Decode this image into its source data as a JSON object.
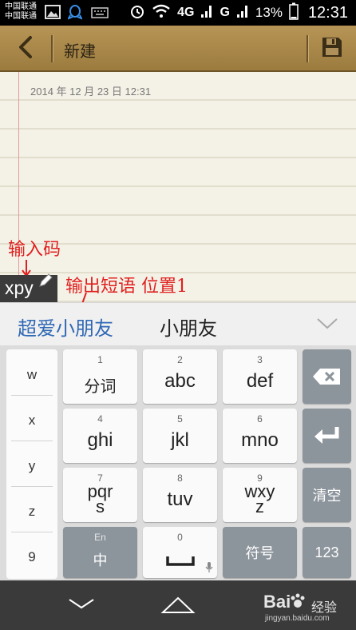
{
  "status_bar": {
    "carrier_1": "中国联通",
    "carrier_2": "中国联通",
    "network_label": "4G",
    "signal2_label": "G",
    "battery": "13%",
    "time": "12:31",
    "icons": [
      "image-icon",
      "qq-icon",
      "keyboard-icon",
      "alarm-icon",
      "wifi-icon",
      "signal-icon",
      "battery-icon"
    ]
  },
  "title_bar": {
    "title": "新建",
    "back_icon": "chevron-left-icon",
    "save_icon": "save-icon"
  },
  "note": {
    "date": "2014 年 12 月 23 日 12:31"
  },
  "annotations": {
    "input_code": "输入码",
    "output_phrase": "输出短语 位置1"
  },
  "ime": {
    "composing": "xpy",
    "candidates": [
      "超爱小朋友",
      "小朋友"
    ],
    "left_column": [
      "w",
      "x",
      "y",
      "z",
      "9"
    ],
    "keys": {
      "k1": {
        "num": "1",
        "label": "分词"
      },
      "k2": {
        "num": "2",
        "label": "abc"
      },
      "k3": {
        "num": "3",
        "label": "def"
      },
      "k4": {
        "num": "4",
        "label": "ghi"
      },
      "k5": {
        "num": "5",
        "label": "jkl"
      },
      "k6": {
        "num": "6",
        "label": "mno"
      },
      "k7": {
        "num": "7",
        "label_top": "pqr",
        "label_bottom": "s"
      },
      "k8": {
        "num": "8",
        "label": "tuv"
      },
      "k9": {
        "num": "9",
        "label_top": "wxy",
        "label_bottom": "z"
      },
      "k0": {
        "num": "0"
      },
      "en": {
        "small": "En",
        "label": "中"
      },
      "symbol": "符号",
      "clear": "清空",
      "num_switch": "123"
    }
  },
  "watermark": {
    "logo": "Bai",
    "suffix": "经验",
    "url": "jingyan.baidu.com"
  },
  "colors": {
    "title_bar": "#a5844a",
    "candidate_highlight": "#2f68b5",
    "annotation": "#e02020",
    "dark_key": "#8c949c"
  }
}
